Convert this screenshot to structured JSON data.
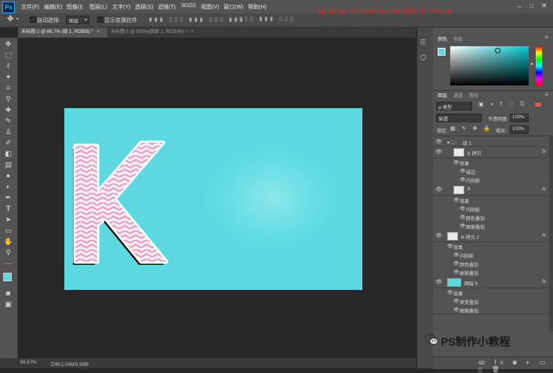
{
  "app": {
    "logo": "Ps",
    "watermark": "www.tongjiansheji.com"
  },
  "menu": [
    "文件(F)",
    "编辑(E)",
    "图像(I)",
    "图层(L)",
    "文字(Y)",
    "选择(S)",
    "滤镜(T)",
    "3D(D)",
    "视图(V)",
    "窗口(W)",
    "帮助(H)"
  ],
  "options": {
    "auto_select_label": "自动选择:",
    "auto_select_value": "图层",
    "show_transform_label": "显示变换控件"
  },
  "doc_tabs": [
    {
      "label": "未标题-2 @ 66.7% (组 1, RGB/8) *",
      "active": true
    },
    {
      "label": "未标题-1 @ 800%(图层 1, RGB/8#) *",
      "active": false
    }
  ],
  "status": {
    "zoom": "66.67%",
    "doc": "文档:2.04M/9.96M"
  },
  "color_panel": {
    "tabs": [
      "颜色",
      "色板"
    ],
    "fg_color": "#5ed8e0",
    "bg_color": "#000000"
  },
  "layers_panel": {
    "tabs": [
      "图层",
      "通道",
      "路径"
    ],
    "filter_kind": "ρ 类型",
    "blend_mode": "穿透",
    "opacity_label": "不透明度:",
    "opacity_value": "100%",
    "lock_label": "锁定:",
    "fill_label": "填充:",
    "fill_value": "100%",
    "rows": [
      {
        "name": "组 1",
        "indent": 0,
        "type": "group",
        "fx": false
      },
      {
        "name": "K 拷贝",
        "indent": 1,
        "type": "layer",
        "fx": true
      },
      {
        "name": "效果",
        "indent": 2,
        "type": "effects",
        "fx": false
      },
      {
        "name": "描边",
        "indent": 3,
        "type": "effect",
        "fx": false
      },
      {
        "name": "内阴影",
        "indent": 3,
        "type": "effect",
        "fx": false
      },
      {
        "name": "K",
        "indent": 1,
        "type": "layer",
        "fx": true
      },
      {
        "name": "效果",
        "indent": 2,
        "type": "effects",
        "fx": false
      },
      {
        "name": "内阴影",
        "indent": 3,
        "type": "effect",
        "fx": false
      },
      {
        "name": "颜色叠加",
        "indent": 3,
        "type": "effect",
        "fx": false
      },
      {
        "name": "图案叠加",
        "indent": 3,
        "type": "effect",
        "fx": false
      },
      {
        "name": "K 拷贝 2",
        "indent": 0,
        "type": "layer",
        "fx": true
      },
      {
        "name": "效果",
        "indent": 1,
        "type": "effects",
        "fx": false
      },
      {
        "name": "内阴影",
        "indent": 2,
        "type": "effect",
        "fx": false
      },
      {
        "name": "颜色叠加",
        "indent": 2,
        "type": "effect",
        "fx": false
      },
      {
        "name": "图案叠加",
        "indent": 2,
        "type": "effect",
        "fx": false
      },
      {
        "name": "图层 0",
        "indent": 0,
        "type": "fill",
        "fx": true
      },
      {
        "name": "效果",
        "indent": 1,
        "type": "effects",
        "fx": false
      },
      {
        "name": "渐变叠加",
        "indent": 2,
        "type": "effect",
        "fx": false
      },
      {
        "name": "图案叠加",
        "indent": 2,
        "type": "effect",
        "fx": false
      }
    ]
  },
  "brand": {
    "text": "PS制作小教程"
  },
  "colors": {
    "canvas": "#5ed8e0",
    "letter_fill": "#e6a8c8",
    "accent_blue": "#31a8ff"
  }
}
